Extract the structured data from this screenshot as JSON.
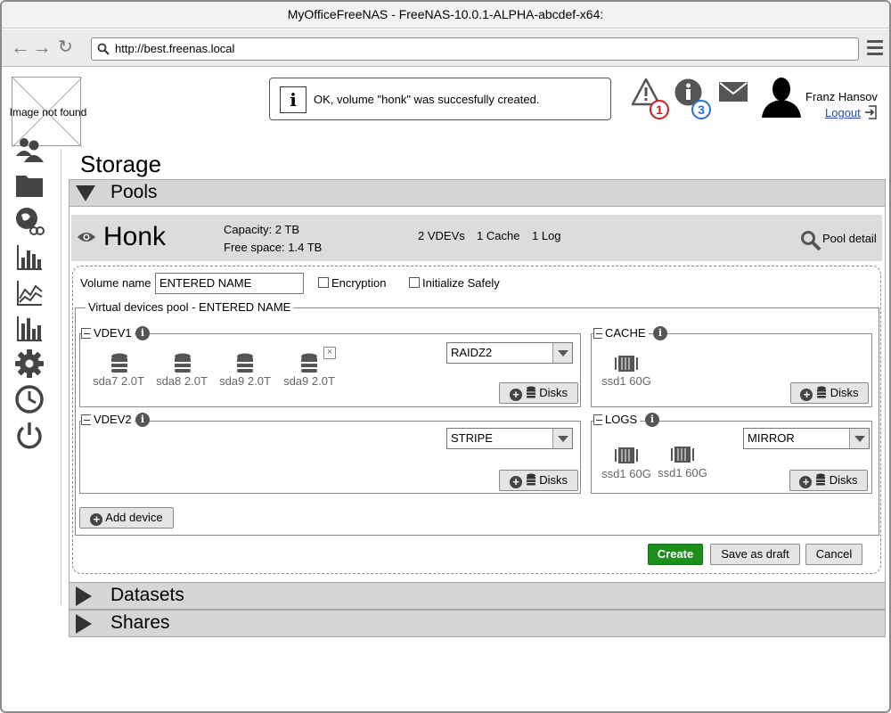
{
  "window": {
    "title": "MyOfficeFreeNAS - FreeNAS-10.0.1-ALPHA-abcdef-x64:"
  },
  "browser": {
    "url": "http://best.freenas.local"
  },
  "logo": {
    "alt": "Image not found"
  },
  "sidebar": {
    "icons": [
      "users-icon",
      "folder-icon",
      "globe-network-icon",
      "bar-chart-icon",
      "line-chart-icon",
      "bar-chart-alt-icon",
      "gear-icon",
      "clock-icon",
      "power-icon"
    ]
  },
  "notification": {
    "message": "OK, volume \"honk\" was succesfully created."
  },
  "header": {
    "alerts_count": "1",
    "info_count": "3",
    "user_name": "Franz Hansov",
    "logout": "Logout"
  },
  "page": {
    "title": "Storage"
  },
  "sections": {
    "pools": "Pools",
    "datasets": "Datasets",
    "shares": "Shares"
  },
  "pool": {
    "name": "Honk",
    "capacity": "Capacity: 2 TB",
    "free_space": "Free space: 1.4 TB",
    "vdevs": "2 VDEVs",
    "cache": "1 Cache",
    "log": "1 Log",
    "detail_link": "Pool detail"
  },
  "form": {
    "volume_name_label": "Volume name",
    "volume_name_value": "ENTERED NAME",
    "encryption_label": "Encryption",
    "init_safely_label": "Initialize Safely",
    "vdev_pool_label": "Virtual devices pool - ENTERED NAME",
    "vdev1": {
      "label": "VDEV1",
      "type": "RAIDZ2",
      "disks": [
        "sda7 2.0T",
        "sda8 2.0T",
        "sda9 2.0T",
        "sda9 2.0T"
      ],
      "add_disks": "Disks"
    },
    "vdev2": {
      "label": "VDEV2",
      "type": "STRIPE",
      "add_disks": "Disks"
    },
    "cache": {
      "label": "CACHE",
      "disks": [
        "ssd1 60G"
      ],
      "add_disks": "Disks"
    },
    "logs": {
      "label": "LOGS",
      "type": "MIRROR",
      "disks": [
        "ssd1 60G",
        "ssd1 60G"
      ],
      "add_disks": "Disks"
    },
    "add_device": "Add device",
    "create": "Create",
    "save_draft": "Save as draft",
    "cancel": "Cancel"
  },
  "colors": {
    "create_button": "#1c8f1c",
    "alert_badge": "#cc1f1f",
    "info_badge": "#2b6fd6",
    "link": "#1f4fa8"
  }
}
